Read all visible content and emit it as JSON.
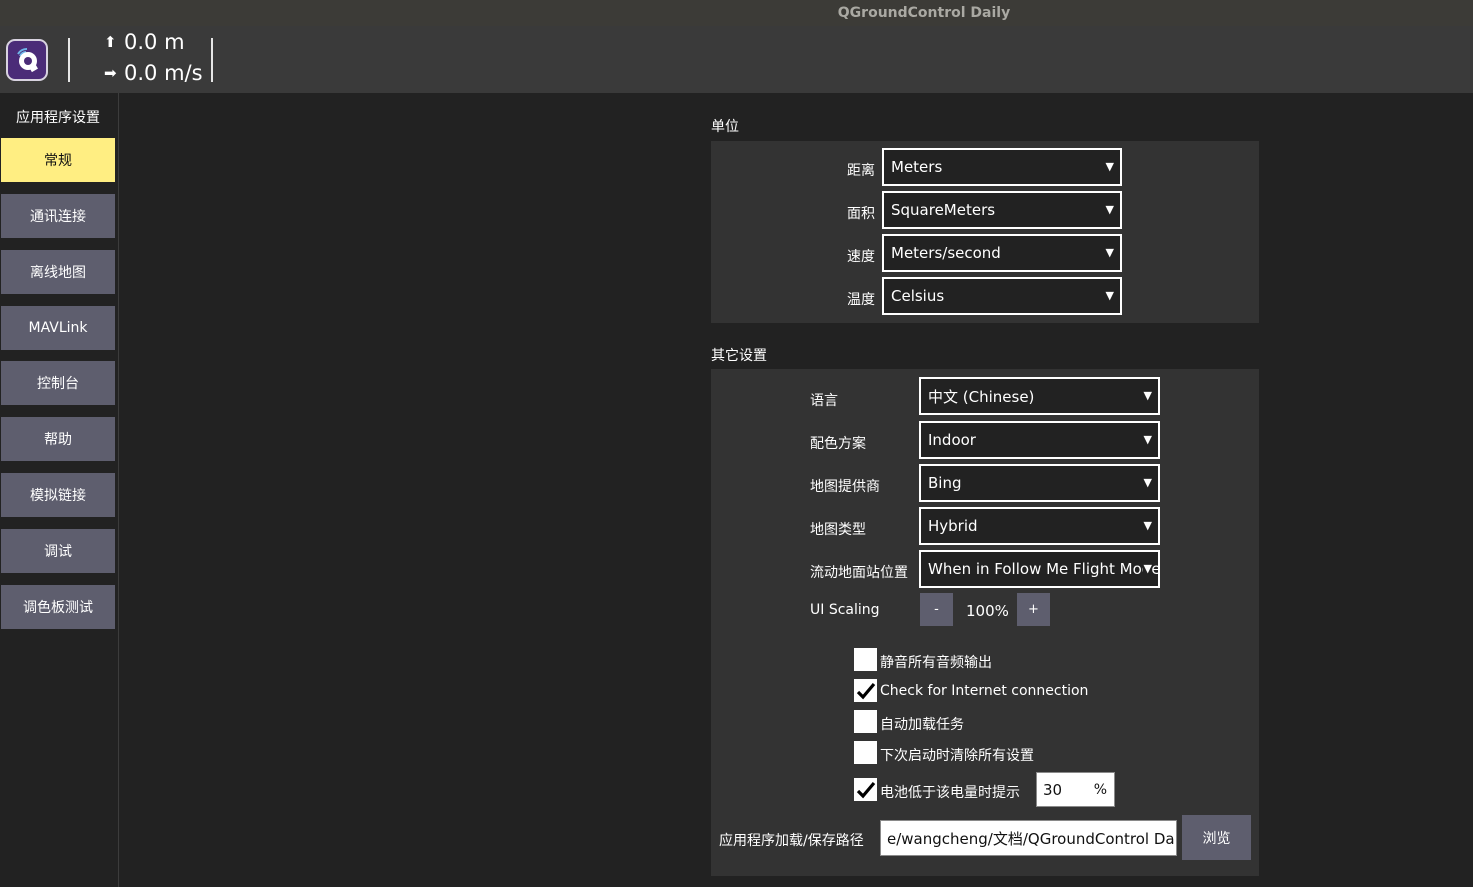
{
  "window": {
    "title": "QGroundControl Daily"
  },
  "toolbar": {
    "logo_icon": "qgc-logo-icon",
    "altitude": {
      "icon": "arrow-up-icon",
      "value": "0.0 m"
    },
    "speed": {
      "icon": "arrow-right-icon",
      "value": "0.0 m/s"
    }
  },
  "sidebar": {
    "heading": "应用程序设置",
    "items": [
      {
        "label": "常规",
        "active": true
      },
      {
        "label": "通讯连接",
        "active": false
      },
      {
        "label": "离线地图",
        "active": false
      },
      {
        "label": "MAVLink",
        "active": false
      },
      {
        "label": "控制台",
        "active": false
      },
      {
        "label": "帮助",
        "active": false
      },
      {
        "label": "模拟链接",
        "active": false
      },
      {
        "label": "调试",
        "active": false
      },
      {
        "label": "调色板测试",
        "active": false
      }
    ]
  },
  "units": {
    "title": "单位",
    "rows": [
      {
        "label": "距离",
        "value": "Meters"
      },
      {
        "label": "面积",
        "value": "SquareMeters"
      },
      {
        "label": "速度",
        "value": "Meters/second"
      },
      {
        "label": "温度",
        "value": "Celsius"
      }
    ]
  },
  "other": {
    "title": "其它设置",
    "rows": [
      {
        "label": "语言",
        "value": "中文 (Chinese)"
      },
      {
        "label": "配色方案",
        "value": "Indoor"
      },
      {
        "label": "地图提供商",
        "value": "Bing"
      },
      {
        "label": "地图类型",
        "value": "Hybrid"
      },
      {
        "label": "流动地面站位置",
        "value": "When in Follow Me Flight Mode"
      }
    ],
    "ui_scaling": {
      "label": "UI Scaling",
      "minus": "-",
      "value": "100%",
      "plus": "+"
    },
    "checkboxes": [
      {
        "label": "静音所有音频输出",
        "checked": false
      },
      {
        "label": "Check for Internet connection",
        "checked": true
      },
      {
        "label": "自动加载任务",
        "checked": false
      },
      {
        "label": "下次启动时清除所有设置",
        "checked": false
      }
    ],
    "battery": {
      "label": "电池低于该电量时提示",
      "checked": true,
      "value": "30",
      "unit": "%"
    },
    "save_path": {
      "label": "应用程序加载/保存路径",
      "value": "e/wangcheng/文档/QGroundControl Daily",
      "browse": "浏览"
    }
  },
  "colors": {
    "accent_active": "#ffee82",
    "button": "#5e5e6e",
    "panel": "#333333",
    "background": "#222222"
  }
}
